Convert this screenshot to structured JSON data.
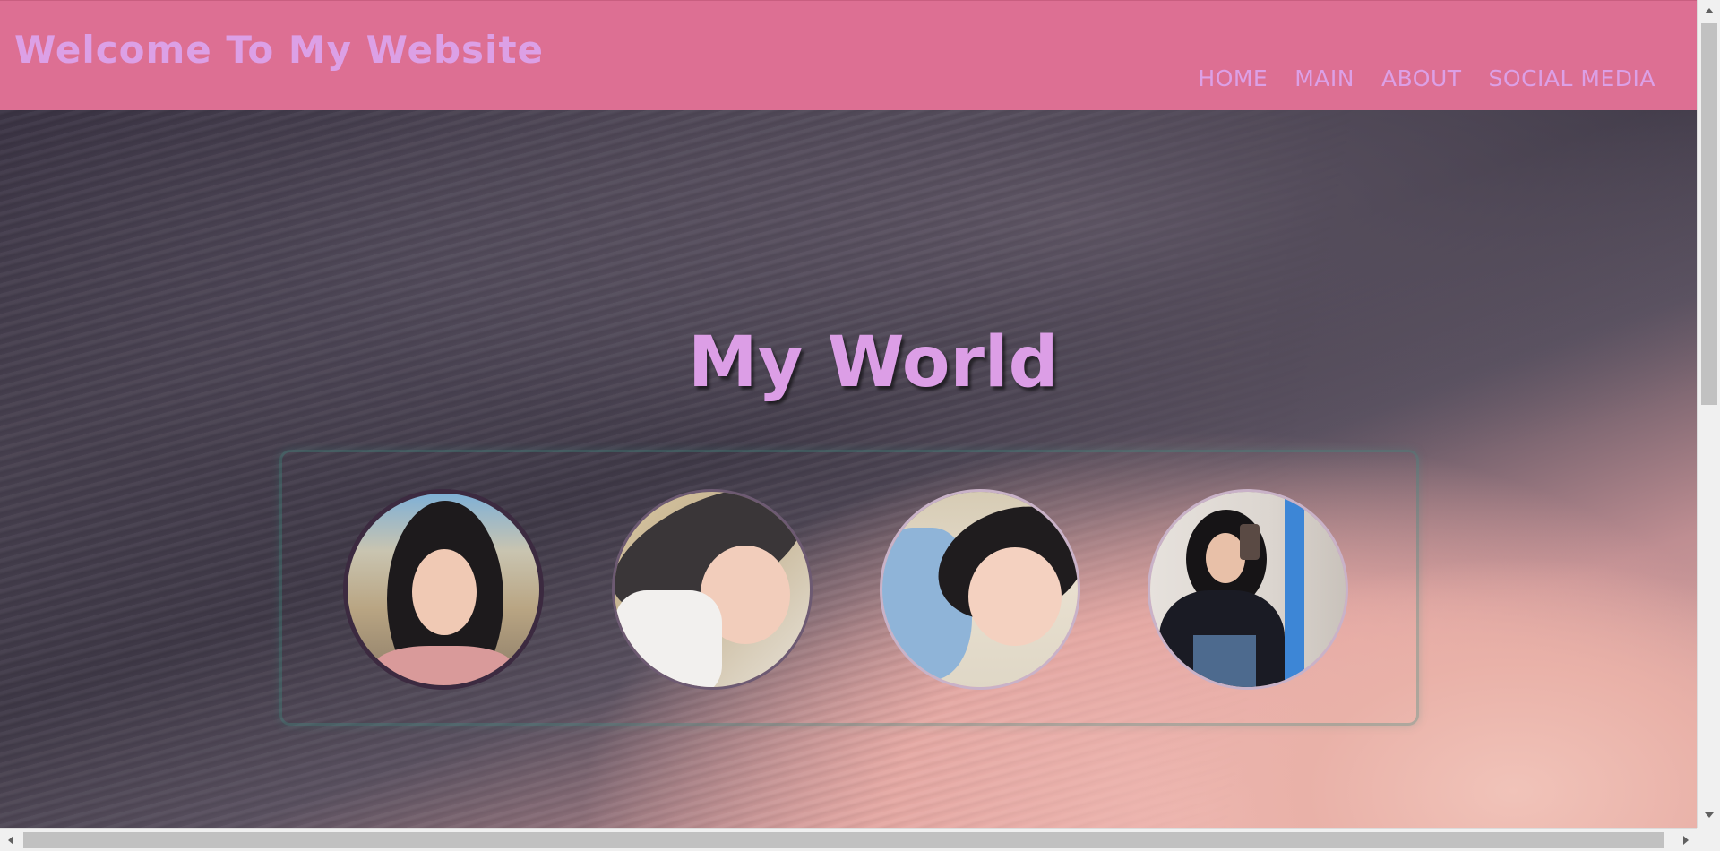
{
  "header": {
    "title": "Welcome To My Website",
    "nav": [
      {
        "label": "HOME"
      },
      {
        "label": "MAIN"
      },
      {
        "label": "ABOUT"
      },
      {
        "label": "SOCIAL MEDIA"
      }
    ]
  },
  "hero": {
    "title": "My World"
  },
  "gallery": {
    "photos": [
      {
        "icon": "profile-photo-1"
      },
      {
        "icon": "profile-photo-2"
      },
      {
        "icon": "profile-photo-3"
      },
      {
        "icon": "profile-photo-4"
      }
    ]
  },
  "colors": {
    "header_bg": "#dd6f93",
    "title_text": "#dca0e6"
  }
}
